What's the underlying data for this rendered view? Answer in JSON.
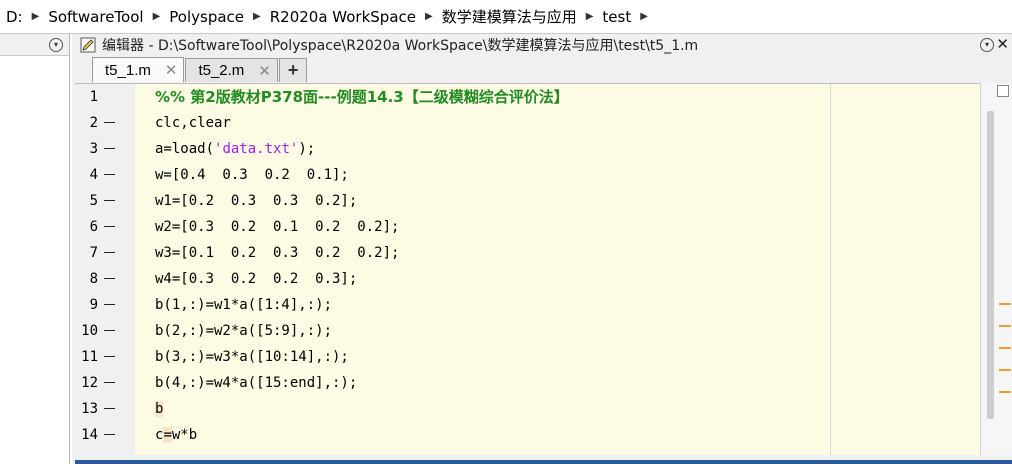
{
  "address": {
    "segments": [
      "D:",
      "SoftwareTool",
      "Polyspace",
      "R2020a WorkSpace",
      "数学建模算法与应用",
      "test"
    ]
  },
  "editor": {
    "title": "编辑器 - D:\\SoftwareTool\\Polyspace\\R2020a WorkSpace\\数学建模算法与应用\\test\\t5_1.m",
    "close_glyph": "✕",
    "menu_glyph": "▾",
    "tabs": [
      {
        "label": "t5_1.m",
        "close": "✕",
        "active": true
      },
      {
        "label": "t5_2.m",
        "close": "✕",
        "active": false
      }
    ],
    "add_tab_glyph": "+"
  },
  "code": {
    "lines": [
      {
        "n": "1",
        "dash": false,
        "parts": [
          {
            "t": "%% 第2版教材P378面---例题14.3【二级模糊综合评价法】",
            "c": "cm"
          }
        ]
      },
      {
        "n": "2",
        "dash": true,
        "parts": [
          {
            "t": "clc,clear",
            "c": ""
          }
        ]
      },
      {
        "n": "3",
        "dash": true,
        "parts": [
          {
            "t": "a=load(",
            "c": ""
          },
          {
            "t": "'data.txt'",
            "c": "str"
          },
          {
            "t": ");",
            "c": ""
          }
        ]
      },
      {
        "n": "4",
        "dash": true,
        "parts": [
          {
            "t": "w=[0.4  0.3  0.2  0.1];",
            "c": ""
          }
        ]
      },
      {
        "n": "5",
        "dash": true,
        "parts": [
          {
            "t": "w1=[0.2  0.3  0.3  0.2];",
            "c": ""
          }
        ]
      },
      {
        "n": "6",
        "dash": true,
        "parts": [
          {
            "t": "w2=[0.3  0.2  0.1  0.2  0.2];",
            "c": ""
          }
        ]
      },
      {
        "n": "7",
        "dash": true,
        "parts": [
          {
            "t": "w3=[0.1  0.2  0.3  0.2  0.2];",
            "c": ""
          }
        ]
      },
      {
        "n": "8",
        "dash": true,
        "parts": [
          {
            "t": "w4=[0.3  0.2  0.2  0.3];",
            "c": ""
          }
        ]
      },
      {
        "n": "9",
        "dash": true,
        "parts": [
          {
            "t": "b(1,:)=w1*a([1:4],:);",
            "c": ""
          }
        ]
      },
      {
        "n": "10",
        "dash": true,
        "parts": [
          {
            "t": "b(2,:)=w2*a([5:9],:);",
            "c": ""
          }
        ]
      },
      {
        "n": "11",
        "dash": true,
        "parts": [
          {
            "t": "b(3,:)=w3*a([10:14],:);",
            "c": ""
          }
        ]
      },
      {
        "n": "12",
        "dash": true,
        "parts": [
          {
            "t": "b(4,:)=w4*a([15:end],:);",
            "c": ""
          }
        ]
      },
      {
        "n": "13",
        "dash": true,
        "parts": [
          {
            "t": "b",
            "c": "cursorhl"
          }
        ]
      },
      {
        "n": "14",
        "dash": true,
        "parts": [
          {
            "t": "c",
            "c": ""
          },
          {
            "t": "=",
            "c": "cursorhl"
          },
          {
            "t": "w*b",
            "c": ""
          }
        ]
      }
    ]
  },
  "indicator_color": "#f39c2a",
  "accent_color": "#2a5b97"
}
